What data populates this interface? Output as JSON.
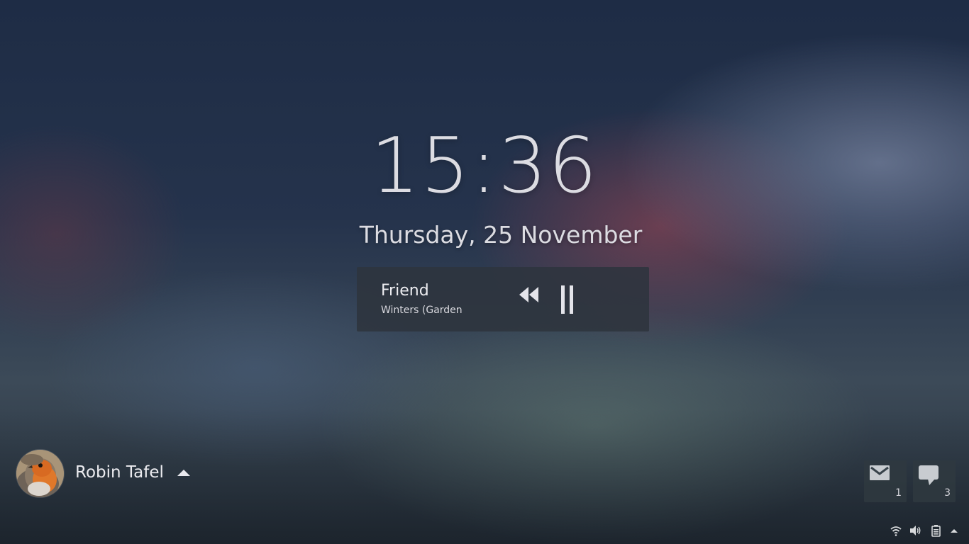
{
  "lockscreen": {
    "time": "15:36",
    "date": "Thursday, 25 November"
  },
  "media": {
    "title": "Friend",
    "artist": "Winters (Garden",
    "controls": [
      "rewind-icon",
      "pause-icon"
    ]
  },
  "user": {
    "name": "Robin Tafel",
    "avatar": "robin-bird-photo",
    "menu_icon": "caret-up-icon"
  },
  "notifications": {
    "mail": {
      "icon": "mail-icon",
      "count": "1"
    },
    "chat": {
      "icon": "chat-bubble-icon",
      "count": "3"
    }
  },
  "tray": {
    "icons": [
      "wifi-icon",
      "volume-icon",
      "battery-icon",
      "caret-up-icon"
    ]
  },
  "colors": {
    "text": "#dcdce2",
    "panel": "#2e343e"
  }
}
